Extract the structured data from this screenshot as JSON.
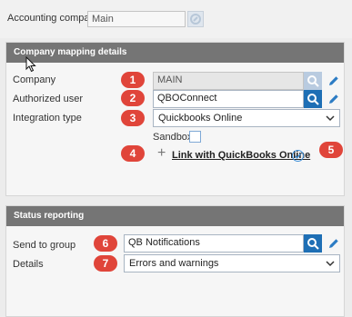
{
  "accounting_company": {
    "label": "Accounting company",
    "value": "Main"
  },
  "mapping": {
    "header": "Company mapping details",
    "company": {
      "label": "Company",
      "value": "MAIN",
      "badge": "1"
    },
    "authorized_user": {
      "label": "Authorized user",
      "value": "QBOConnect",
      "badge": "2"
    },
    "integration_type": {
      "label": "Integration type",
      "value": "Quickbooks Online",
      "badge": "3"
    },
    "sandbox": {
      "label": "Sandbox",
      "checked": false
    },
    "link": {
      "label": "Link with QuickBooks Online",
      "badge": "4",
      "status_badge": "5"
    }
  },
  "status": {
    "header": "Status reporting",
    "send_to_group": {
      "label": "Send to group",
      "value": "QB Notifications",
      "badge": "6"
    },
    "details": {
      "label": "Details",
      "value": "Errors and warnings",
      "badge": "7"
    }
  },
  "colors": {
    "accent": "#1e6fb5",
    "badge": "#e0453a",
    "header": "#757575"
  },
  "icons": [
    "link-icon",
    "search-icon",
    "pencil-icon",
    "chevron-down-icon",
    "plus-icon",
    "check-circle-icon",
    "mouse-cursor-icon"
  ]
}
